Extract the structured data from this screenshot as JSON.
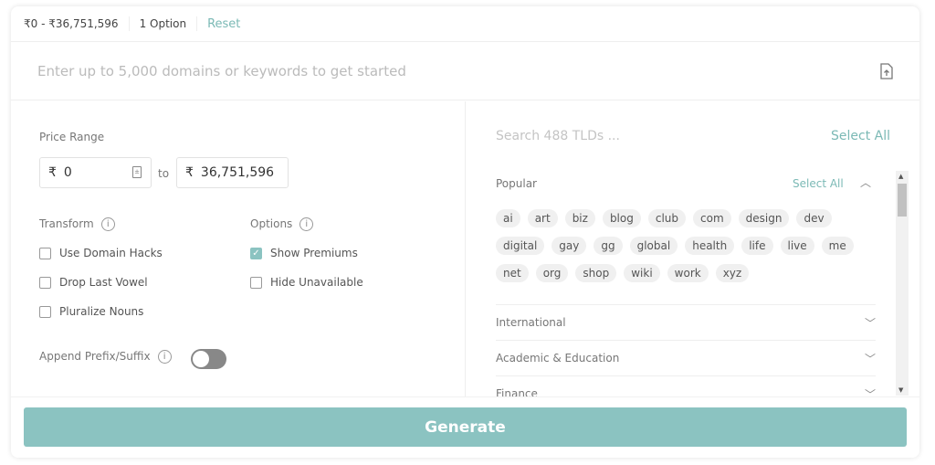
{
  "summary": {
    "price_range": "₹0 - ₹36,751,596",
    "options": "1 Option",
    "reset": "Reset"
  },
  "search": {
    "placeholder": "Enter up to 5,000 domains or keywords to get started",
    "upload_icon": "file-upload-icon"
  },
  "price": {
    "label": "Price Range",
    "currency": "₹",
    "min": "0",
    "to": "to",
    "max": "36,751,596"
  },
  "transform": {
    "label": "Transform",
    "items": [
      {
        "label": "Use Domain Hacks",
        "checked": false
      },
      {
        "label": "Drop Last Vowel",
        "checked": false
      },
      {
        "label": "Pluralize Nouns",
        "checked": false
      }
    ]
  },
  "options": {
    "label": "Options",
    "items": [
      {
        "label": "Show Premiums",
        "checked": true
      },
      {
        "label": "Hide Unavailable",
        "checked": false
      }
    ]
  },
  "append": {
    "label": "Append Prefix/Suffix",
    "enabled": false
  },
  "tld": {
    "search_placeholder": "Search 488 TLDs ...",
    "select_all": "Select All",
    "popular": {
      "label": "Popular",
      "select_all": "Select All",
      "tags": [
        "ai",
        "art",
        "biz",
        "blog",
        "club",
        "com",
        "design",
        "dev",
        "digital",
        "gay",
        "gg",
        "global",
        "health",
        "life",
        "live",
        "me",
        "net",
        "org",
        "shop",
        "wiki",
        "work",
        "xyz"
      ]
    },
    "categories": [
      "International",
      "Academic & Education",
      "Finance"
    ]
  },
  "generate": "Generate",
  "colors": {
    "accent": "#8bc3c1"
  }
}
